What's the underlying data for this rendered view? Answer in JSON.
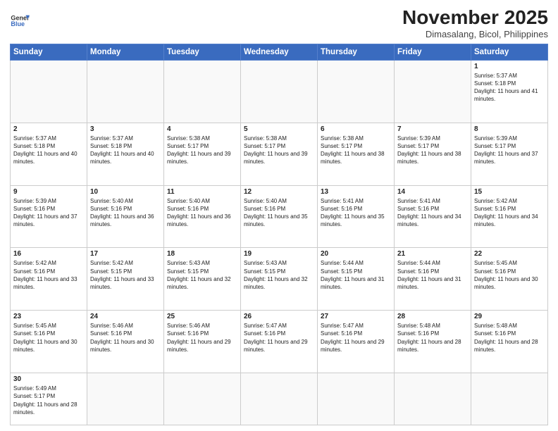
{
  "logo": {
    "line1": "General",
    "line2": "Blue"
  },
  "title": "November 2025",
  "subtitle": "Dimasalang, Bicol, Philippines",
  "weekdays": [
    "Sunday",
    "Monday",
    "Tuesday",
    "Wednesday",
    "Thursday",
    "Friday",
    "Saturday"
  ],
  "weeks": [
    [
      {
        "day": "",
        "info": ""
      },
      {
        "day": "",
        "info": ""
      },
      {
        "day": "",
        "info": ""
      },
      {
        "day": "",
        "info": ""
      },
      {
        "day": "",
        "info": ""
      },
      {
        "day": "",
        "info": ""
      },
      {
        "day": "1",
        "info": "Sunrise: 5:37 AM\nSunset: 5:18 PM\nDaylight: 11 hours and 41 minutes."
      }
    ],
    [
      {
        "day": "2",
        "info": "Sunrise: 5:37 AM\nSunset: 5:18 PM\nDaylight: 11 hours and 40 minutes."
      },
      {
        "day": "3",
        "info": "Sunrise: 5:37 AM\nSunset: 5:18 PM\nDaylight: 11 hours and 40 minutes."
      },
      {
        "day": "4",
        "info": "Sunrise: 5:38 AM\nSunset: 5:17 PM\nDaylight: 11 hours and 39 minutes."
      },
      {
        "day": "5",
        "info": "Sunrise: 5:38 AM\nSunset: 5:17 PM\nDaylight: 11 hours and 39 minutes."
      },
      {
        "day": "6",
        "info": "Sunrise: 5:38 AM\nSunset: 5:17 PM\nDaylight: 11 hours and 38 minutes."
      },
      {
        "day": "7",
        "info": "Sunrise: 5:39 AM\nSunset: 5:17 PM\nDaylight: 11 hours and 38 minutes."
      },
      {
        "day": "8",
        "info": "Sunrise: 5:39 AM\nSunset: 5:17 PM\nDaylight: 11 hours and 37 minutes."
      }
    ],
    [
      {
        "day": "9",
        "info": "Sunrise: 5:39 AM\nSunset: 5:16 PM\nDaylight: 11 hours and 37 minutes."
      },
      {
        "day": "10",
        "info": "Sunrise: 5:40 AM\nSunset: 5:16 PM\nDaylight: 11 hours and 36 minutes."
      },
      {
        "day": "11",
        "info": "Sunrise: 5:40 AM\nSunset: 5:16 PM\nDaylight: 11 hours and 36 minutes."
      },
      {
        "day": "12",
        "info": "Sunrise: 5:40 AM\nSunset: 5:16 PM\nDaylight: 11 hours and 35 minutes."
      },
      {
        "day": "13",
        "info": "Sunrise: 5:41 AM\nSunset: 5:16 PM\nDaylight: 11 hours and 35 minutes."
      },
      {
        "day": "14",
        "info": "Sunrise: 5:41 AM\nSunset: 5:16 PM\nDaylight: 11 hours and 34 minutes."
      },
      {
        "day": "15",
        "info": "Sunrise: 5:42 AM\nSunset: 5:16 PM\nDaylight: 11 hours and 34 minutes."
      }
    ],
    [
      {
        "day": "16",
        "info": "Sunrise: 5:42 AM\nSunset: 5:16 PM\nDaylight: 11 hours and 33 minutes."
      },
      {
        "day": "17",
        "info": "Sunrise: 5:42 AM\nSunset: 5:15 PM\nDaylight: 11 hours and 33 minutes."
      },
      {
        "day": "18",
        "info": "Sunrise: 5:43 AM\nSunset: 5:15 PM\nDaylight: 11 hours and 32 minutes."
      },
      {
        "day": "19",
        "info": "Sunrise: 5:43 AM\nSunset: 5:15 PM\nDaylight: 11 hours and 32 minutes."
      },
      {
        "day": "20",
        "info": "Sunrise: 5:44 AM\nSunset: 5:15 PM\nDaylight: 11 hours and 31 minutes."
      },
      {
        "day": "21",
        "info": "Sunrise: 5:44 AM\nSunset: 5:16 PM\nDaylight: 11 hours and 31 minutes."
      },
      {
        "day": "22",
        "info": "Sunrise: 5:45 AM\nSunset: 5:16 PM\nDaylight: 11 hours and 30 minutes."
      }
    ],
    [
      {
        "day": "23",
        "info": "Sunrise: 5:45 AM\nSunset: 5:16 PM\nDaylight: 11 hours and 30 minutes."
      },
      {
        "day": "24",
        "info": "Sunrise: 5:46 AM\nSunset: 5:16 PM\nDaylight: 11 hours and 30 minutes."
      },
      {
        "day": "25",
        "info": "Sunrise: 5:46 AM\nSunset: 5:16 PM\nDaylight: 11 hours and 29 minutes."
      },
      {
        "day": "26",
        "info": "Sunrise: 5:47 AM\nSunset: 5:16 PM\nDaylight: 11 hours and 29 minutes."
      },
      {
        "day": "27",
        "info": "Sunrise: 5:47 AM\nSunset: 5:16 PM\nDaylight: 11 hours and 29 minutes."
      },
      {
        "day": "28",
        "info": "Sunrise: 5:48 AM\nSunset: 5:16 PM\nDaylight: 11 hours and 28 minutes."
      },
      {
        "day": "29",
        "info": "Sunrise: 5:48 AM\nSunset: 5:16 PM\nDaylight: 11 hours and 28 minutes."
      }
    ],
    [
      {
        "day": "30",
        "info": "Sunrise: 5:49 AM\nSunset: 5:17 PM\nDaylight: 11 hours and 28 minutes."
      },
      {
        "day": "",
        "info": ""
      },
      {
        "day": "",
        "info": ""
      },
      {
        "day": "",
        "info": ""
      },
      {
        "day": "",
        "info": ""
      },
      {
        "day": "",
        "info": ""
      },
      {
        "day": "",
        "info": ""
      }
    ]
  ]
}
